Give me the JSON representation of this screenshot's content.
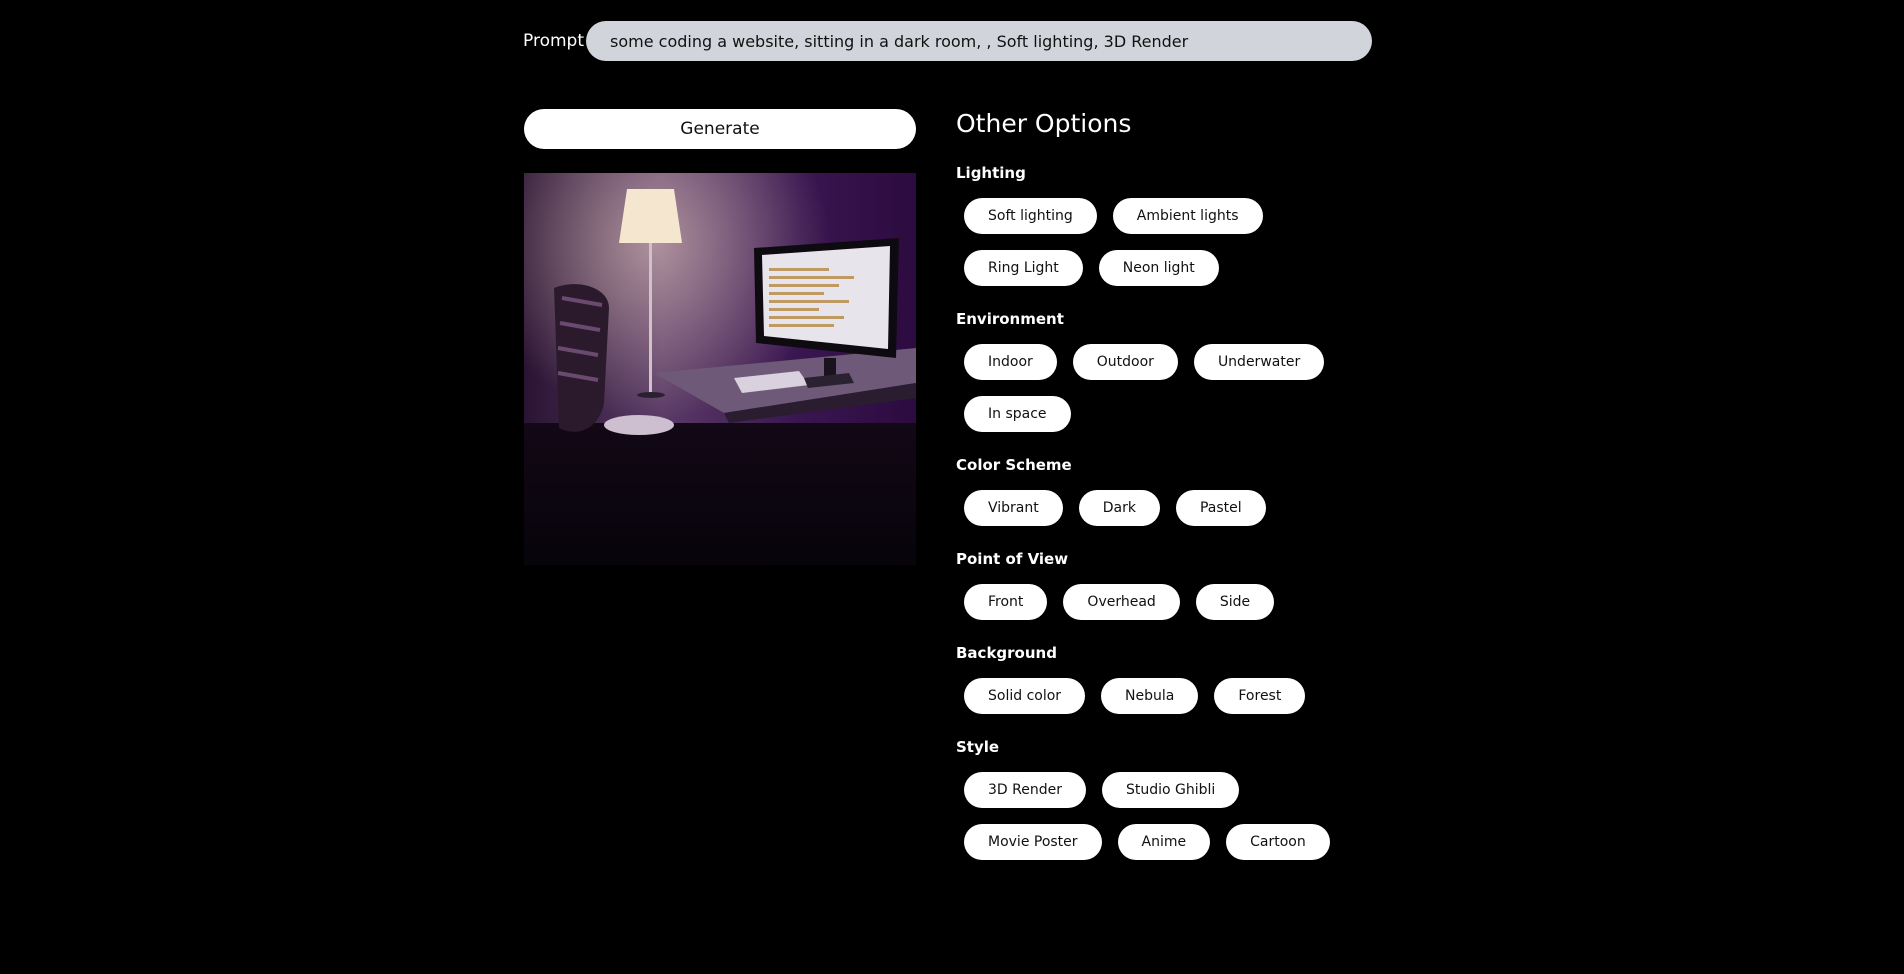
{
  "prompt": {
    "label": "Prompt",
    "value": "some coding a website, sitting in a dark room, , Soft lighting, 3D Render"
  },
  "generate": {
    "label": "Generate"
  },
  "options": {
    "title": "Other Options",
    "sections": [
      {
        "title": "Lighting",
        "chips": [
          "Soft lighting",
          "Ambient lights",
          "Ring Light",
          "Neon light"
        ]
      },
      {
        "title": "Environment",
        "chips": [
          "Indoor",
          "Outdoor",
          "Underwater",
          "In space"
        ]
      },
      {
        "title": "Color Scheme",
        "chips": [
          "Vibrant",
          "Dark",
          "Pastel"
        ]
      },
      {
        "title": "Point of View",
        "chips": [
          "Front",
          "Overhead",
          "Side"
        ]
      },
      {
        "title": "Background",
        "chips": [
          "Solid color",
          "Nebula",
          "Forest"
        ]
      },
      {
        "title": "Style",
        "chips": [
          "3D Render",
          "Studio Ghibli",
          "Movie Poster",
          "Anime",
          "Cartoon"
        ]
      }
    ]
  },
  "colors": {
    "background": "#000000",
    "input_bg": "#d1d5db",
    "chip_bg": "#ffffff",
    "image_accent": "#4b1e63"
  }
}
